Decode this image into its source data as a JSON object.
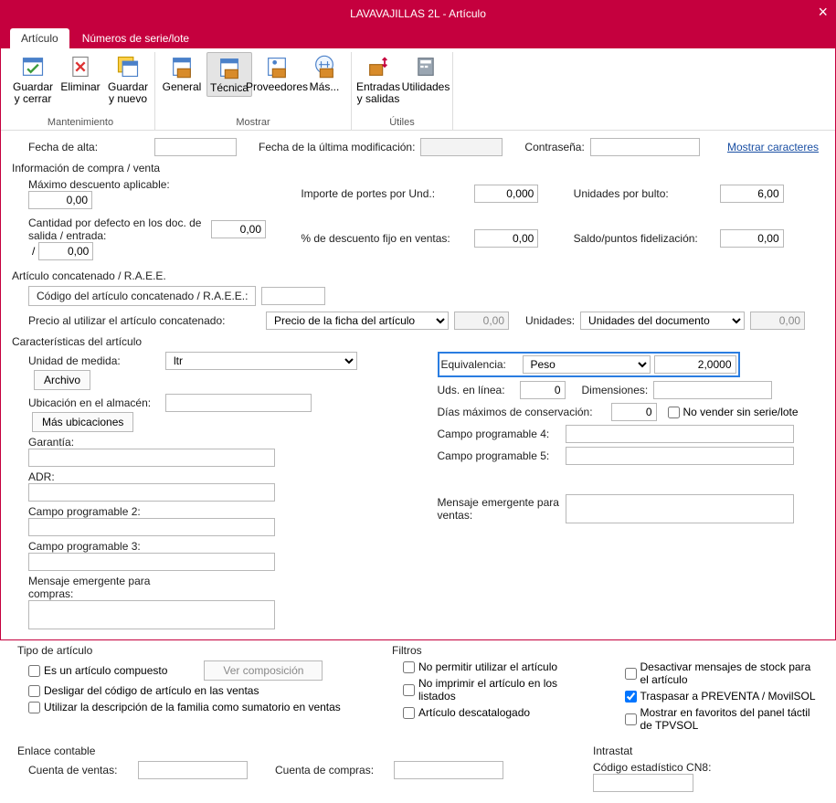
{
  "window": {
    "title": "LAVAVAJILLAS 2L - Artículo"
  },
  "tabs": {
    "articulo": "Artículo",
    "series": "Números de serie/lote"
  },
  "ribbon": {
    "guardarCerrar": "Guardar y cerrar",
    "eliminar": "Eliminar",
    "guardarNuevo": "Guardar y nuevo",
    "general": "General",
    "tecnica": "Técnica",
    "proveedores": "Proveedores",
    "mas": "Más...",
    "entradasSalidas": "Entradas y salidas",
    "utilidades": "Utilidades",
    "grpMant": "Mantenimiento",
    "grpMostrar": "Mostrar",
    "grpUtiles": "Útiles"
  },
  "top": {
    "fechaAlta": "Fecha de alta:",
    "fechaAltaVal": "",
    "fechaMod": "Fecha de la última modificación:",
    "fechaModVal": "",
    "contrasena": "Contraseña:",
    "contrasenaVal": "",
    "mostrarCaracteres": "Mostrar caracteres"
  },
  "compraVenta": {
    "title": "Información de compra / venta",
    "maxDesc": "Máximo descuento aplicable:",
    "maxDescVal": "0,00",
    "cantDef": "Cantidad por defecto en los doc. de salida / entrada:",
    "cantDefSal": "0,00",
    "cantDefEnt": "0,00",
    "sep": "/",
    "impPortes": "Importe de portes por Und.:",
    "impPortesVal": "0,000",
    "pctDesc": "% de descuento fijo en ventas:",
    "pctDescVal": "0,00",
    "udsBulto": "Unidades por bulto:",
    "udsBultoVal": "6,00",
    "saldo": "Saldo/puntos fidelización:",
    "saldoVal": "0,00"
  },
  "concat": {
    "title": "Artículo concatenado / R.A.E.E.",
    "codigo": "Código del artículo concatenado / R.A.E.E.:",
    "codigoVal": "",
    "precio": "Precio al utilizar el artículo concatenado:",
    "precioOpt": "Precio de la ficha del artículo",
    "precioVal": "0,00",
    "unidades": "Unidades:",
    "unidadesOpt": "Unidades del documento",
    "unidadesVal": "0,00"
  },
  "caract": {
    "title": "Características del artículo",
    "udMedida": "Unidad de medida:",
    "udMedidaVal": "ltr",
    "archivo": "Archivo",
    "equivalencia": "Equivalencia:",
    "equivalenciaOpt": "Peso",
    "equivalenciaVal": "2,0000",
    "ubicacion": "Ubicación en el almacén:",
    "masUbic": "Más ubicaciones",
    "udsLinea": "Uds. en línea:",
    "udsLineaVal": "0",
    "dimensiones": "Dimensiones:",
    "garantia": "Garantía:",
    "diasMax": "Días máximos de conservación:",
    "diasMaxVal": "0",
    "noVender": "No vender sin serie/lote",
    "adr": "ADR:",
    "cp4": "Campo programable 4:",
    "cp2": "Campo programable 2:",
    "cp5": "Campo programable 5:",
    "cp3": "Campo programable 3:",
    "msgCompras": "Mensaje emergente para compras:",
    "msgVentas": "Mensaje emergente para ventas:"
  },
  "tipoArt": {
    "title": "Tipo de artículo",
    "compuesto": "Es un artículo compuesto",
    "verComp": "Ver composición",
    "desligar": "Desligar del código de artículo en las ventas",
    "descFamilia": "Utilizar la descripción de la familia como sumatorio en ventas"
  },
  "filtros": {
    "title": "Filtros",
    "noPermitir": "No permitir utilizar el artículo",
    "noImprimir": "No imprimir el artículo en los listados",
    "descatalogado": "Artículo descatalogado",
    "desactStock": "Desactivar mensajes de stock para el artículo",
    "traspasar": "Traspasar a PREVENTA / MovilSOL",
    "favoritos": "Mostrar en favoritos del panel táctil de TPVSOL"
  },
  "enlace": {
    "title": "Enlace contable",
    "ventas": "Cuenta de ventas:",
    "compras": "Cuenta de compras:"
  },
  "intrastat": {
    "title": "Intrastat",
    "cn8": "Código estadístico CN8:"
  }
}
